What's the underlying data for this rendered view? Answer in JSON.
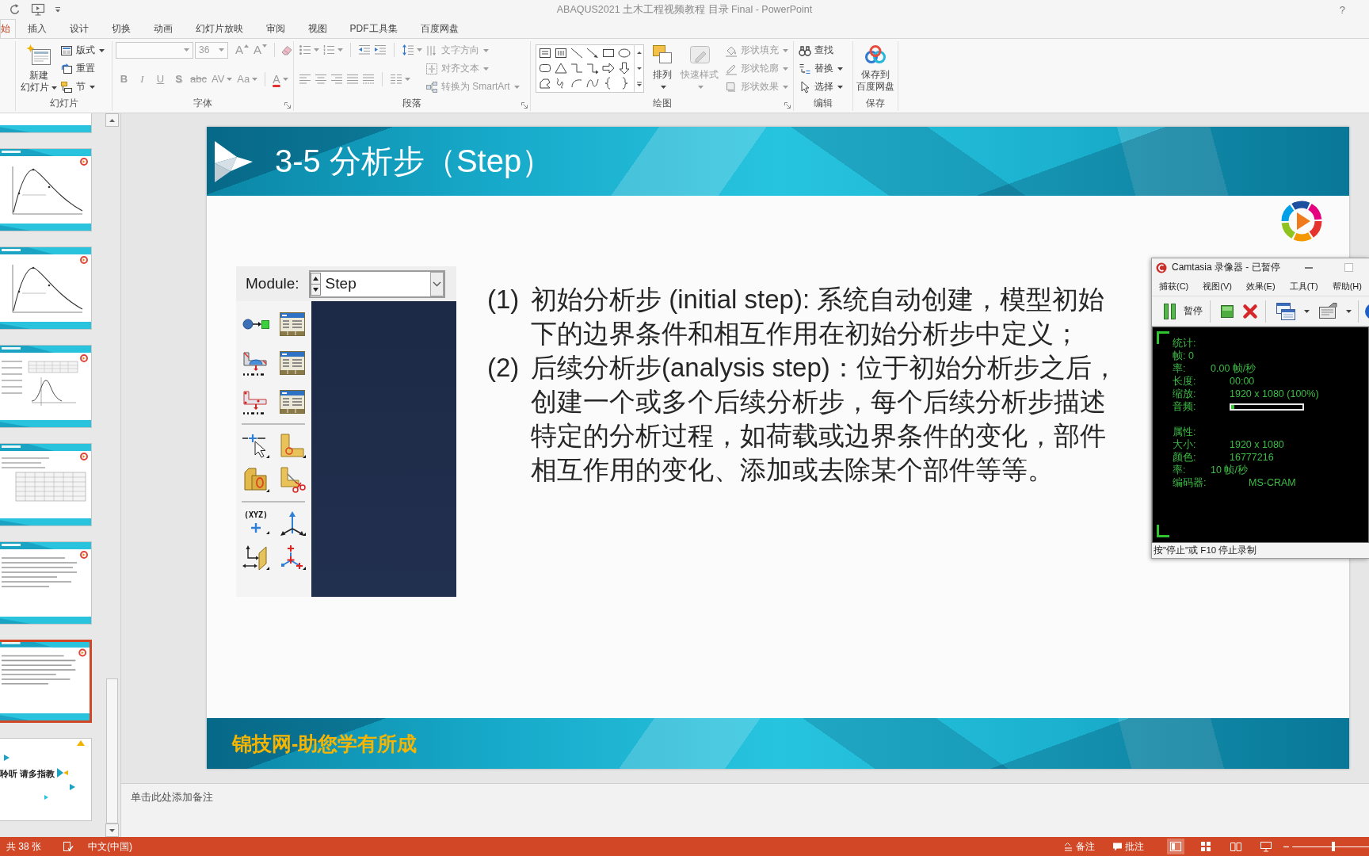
{
  "window": {
    "title": "ABAQUS2021 土木工程视频教程 目录 Final - PowerPoint",
    "help": "?"
  },
  "tabs": [
    {
      "label": "始",
      "selected": true
    },
    {
      "label": "插入",
      "selected": false
    },
    {
      "label": "设计",
      "selected": false
    },
    {
      "label": "切换",
      "selected": false
    },
    {
      "label": "动画",
      "selected": false
    },
    {
      "label": "幻灯片放映",
      "selected": false
    },
    {
      "label": "审阅",
      "selected": false
    },
    {
      "label": "视图",
      "selected": false
    },
    {
      "label": "PDF工具集",
      "selected": false
    },
    {
      "label": "百度网盘",
      "selected": false
    }
  ],
  "ribbon": {
    "groups": [
      {
        "kind": "slides",
        "label": "幻灯片",
        "large": {
          "lines": [
            "新建",
            "幻灯片"
          ],
          "dropdown": true,
          "disabled": false
        },
        "buttons": [
          {
            "kind": "layout",
            "label": "版式",
            "dropdown": true,
            "disabled": false
          },
          {
            "kind": "reset",
            "label": "重置",
            "disabled": false
          },
          {
            "kind": "section",
            "label": "节",
            "dropdown": true,
            "disabled": false
          }
        ]
      },
      {
        "kind": "font",
        "label": "字体",
        "launcher": true,
        "disabled": true,
        "size": "36",
        "size_buttons": [
          {
            "kind": "grow",
            "text": "A"
          },
          {
            "kind": "shrink",
            "text": "A"
          }
        ],
        "formats": [
          {
            "kind": "bold",
            "text": "B"
          },
          {
            "kind": "italic",
            "text": "I"
          },
          {
            "kind": "underline",
            "text": "U"
          },
          {
            "kind": "shadow",
            "text": "S"
          },
          {
            "kind": "strike",
            "text": "abc"
          },
          {
            "kind": "spacing",
            "text": "AV",
            "dropdown": true
          },
          {
            "kind": "case",
            "text": "Aa",
            "dropdown": true
          },
          {
            "kind": "color",
            "text": "A",
            "dropdown": true
          }
        ]
      },
      {
        "kind": "paragraph",
        "label": "段落",
        "launcher": true,
        "disabled": true,
        "buttons": [
          {
            "kind": "direction",
            "label": "文字方向",
            "dropdown": true
          },
          {
            "kind": "align",
            "label": "对齐文本",
            "dropdown": true
          },
          {
            "kind": "smartart",
            "label": "转换为 SmartArt",
            "dropdown": true
          }
        ]
      },
      {
        "kind": "drawing",
        "label": "绘图",
        "launcher": true,
        "large": [
          {
            "kind": "arrange",
            "lines": [
              "排列"
            ],
            "dropdown": true,
            "disabled": false
          },
          {
            "kind": "styles",
            "lines": [
              "快速样式"
            ],
            "dropdown": true,
            "disabled": true
          }
        ],
        "buttons": [
          {
            "kind": "fill",
            "label": "形状填充",
            "dropdown": true,
            "disabled": true
          },
          {
            "kind": "outline",
            "label": "形状轮廓",
            "dropdown": true,
            "disabled": true
          },
          {
            "kind": "effects",
            "label": "形状效果",
            "dropdown": true,
            "disabled": true
          }
        ]
      },
      {
        "kind": "editing",
        "label": "编辑",
        "buttons": [
          {
            "kind": "find",
            "label": "查找",
            "disabled": false
          },
          {
            "kind": "replace",
            "label": "替换",
            "dropdown": true,
            "disabled": false
          },
          {
            "kind": "select",
            "label": "选择",
            "dropdown": true,
            "disabled": false
          }
        ]
      },
      {
        "kind": "save",
        "label": "保存",
        "large": {
          "lines": [
            "保存到",
            "百度网盘"
          ],
          "disabled": false
        }
      }
    ]
  },
  "thumbnails": [
    {
      "kind": "table",
      "selected": false
    },
    {
      "kind": "curve",
      "selected": false
    },
    {
      "kind": "curve",
      "selected": false
    },
    {
      "kind": "chart",
      "selected": false
    },
    {
      "kind": "table",
      "selected": false
    },
    {
      "kind": "text",
      "selected": false
    },
    {
      "kind": "text",
      "selected": true
    },
    {
      "kind": "closing",
      "selected": false,
      "text": "聆听 请多指教"
    }
  ],
  "slide": {
    "title": "3-5 分析步（Step）",
    "module_panel": {
      "label": "Module:",
      "value": "Step",
      "coordinate_tool": "(XYZ)"
    },
    "points": [
      {
        "number": "(1)",
        "lines": [
          "初始分析步 (initial step): 系统自动创建，模型初始",
          "下的边界条件和相互作用在初始分析步中定义；"
        ]
      },
      {
        "number": "(2)",
        "lines": [
          "后续分析步(analysis step)：位于初始分析步之后，",
          "创建一个或多个后续分析步，每个后续分析步描述",
          "特定的分析过程，如荷载或边界条件的变化，部件",
          "相互作用的变化、添加或去除某个部件等等。"
        ]
      }
    ],
    "footer": "锦技网-助您学有所成"
  },
  "notes": {
    "placeholder": "单击此处添加备注"
  },
  "status_bar": {
    "slide_count": "共 38 张",
    "language": "中文(中国)",
    "buttons": [
      {
        "kind": "notes",
        "label": "备注"
      },
      {
        "kind": "comments",
        "label": "批注"
      }
    ],
    "views": [
      {
        "kind": "normal",
        "selected": true
      },
      {
        "kind": "sorter",
        "selected": false
      },
      {
        "kind": "reading",
        "selected": false
      },
      {
        "kind": "slideshow",
        "selected": false
      }
    ],
    "zoom": {
      "level": 0.54
    }
  },
  "recorder": {
    "title": "Camtasia 录像器 - 已暂停",
    "menu": [
      "捕获(C)",
      "视图(V)",
      "效果(E)",
      "工具(T)",
      "帮助(H)"
    ],
    "pause_label": "暂停",
    "sections": [
      {
        "title": "统计:",
        "rows": [
          {
            "kind": "text",
            "label": "帧: 0"
          },
          {
            "kind": "text",
            "label": "率:",
            "value": "0.00 帧/秒"
          },
          {
            "kind": "text",
            "label": "长度:",
            "value": "00:00"
          },
          {
            "kind": "text",
            "label": "缩放:",
            "value": "1920 x 1080 (100%)"
          },
          {
            "kind": "meter",
            "label": "音频:",
            "level": 0.04
          }
        ]
      },
      {
        "title": "属性:",
        "rows": [
          {
            "kind": "text",
            "label": "大小:",
            "value": "1920 x 1080"
          },
          {
            "kind": "text",
            "label": "颜色:",
            "value": "16777216"
          },
          {
            "kind": "text",
            "label": "率:",
            "value": "10 帧/秒"
          },
          {
            "kind": "text",
            "label": "编码器:",
            "value": "MS-CRAM"
          }
        ]
      }
    ],
    "status": "按\"停止\"或 F10 停止录制"
  }
}
